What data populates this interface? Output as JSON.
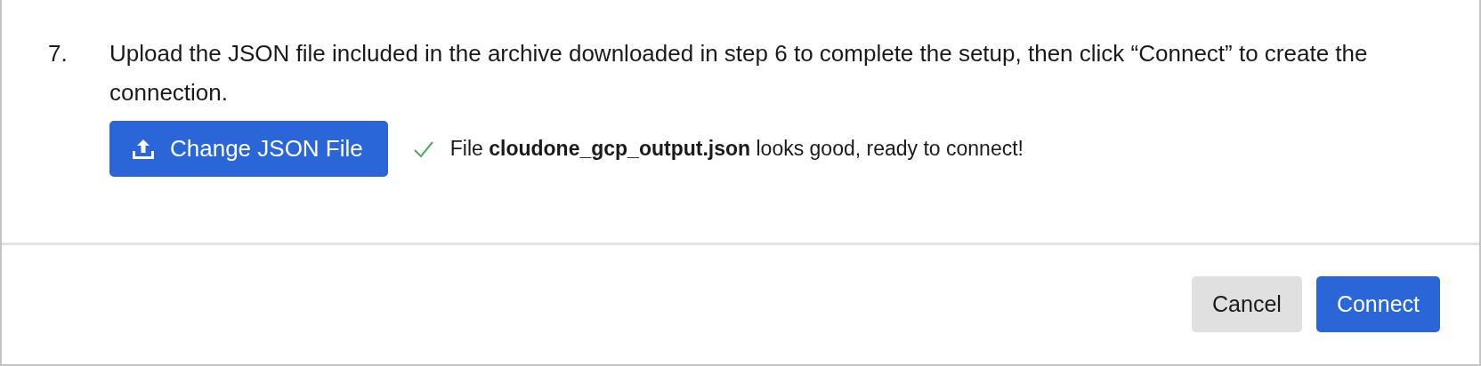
{
  "step": {
    "number": "7.",
    "text": "Upload the JSON file included in the archive downloaded in step 6 to complete the setup, then click “Connect” to create the connection."
  },
  "upload_button": {
    "label": "Change JSON File"
  },
  "status": {
    "kind": "success",
    "text": "File **cloudone_gcp_output.json** looks good, ready to connect!"
  },
  "footer_buttons": [
    {
      "label": "Cancel",
      "kind": "secondary"
    },
    {
      "label": "Connect",
      "kind": "primary"
    }
  ]
}
